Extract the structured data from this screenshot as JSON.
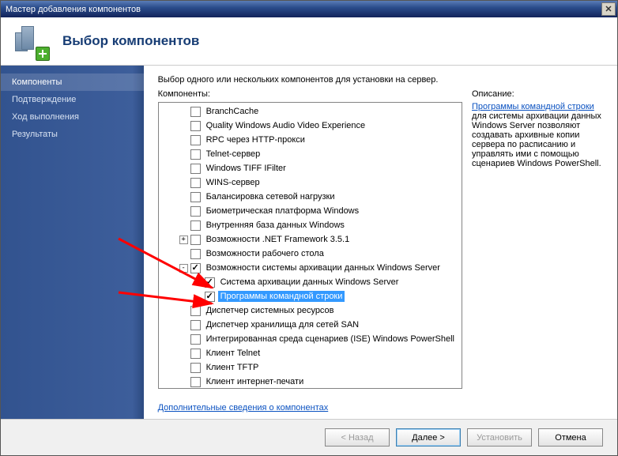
{
  "window": {
    "title": "Мастер добавления компонентов"
  },
  "header": {
    "title": "Выбор компонентов"
  },
  "sidebar": {
    "steps": [
      {
        "label": "Компоненты",
        "current": true
      },
      {
        "label": "Подтверждение",
        "current": false
      },
      {
        "label": "Ход выполнения",
        "current": false
      },
      {
        "label": "Результаты",
        "current": false
      }
    ]
  },
  "main": {
    "instruction": "Выбор одного или нескольких компонентов для установки на сервер.",
    "components_label": "Компоненты:",
    "description_label": "Описание:",
    "more_info": "Дополнительные сведения о компонентах"
  },
  "tree": [
    {
      "label": "BranchCache",
      "depth": 0,
      "checked": false
    },
    {
      "label": "Quality Windows Audio Video Experience",
      "depth": 0,
      "checked": false
    },
    {
      "label": "RPC через HTTP-прокси",
      "depth": 0,
      "checked": false
    },
    {
      "label": "Telnet-сервер",
      "depth": 0,
      "checked": false
    },
    {
      "label": "Windows TIFF IFilter",
      "depth": 0,
      "checked": false
    },
    {
      "label": "WINS-сервер",
      "depth": 0,
      "checked": false
    },
    {
      "label": "Балансировка сетевой нагрузки",
      "depth": 0,
      "checked": false
    },
    {
      "label": "Биометрическая платформа Windows",
      "depth": 0,
      "checked": false
    },
    {
      "label": "Внутренняя база данных Windows",
      "depth": 0,
      "checked": false
    },
    {
      "label": "Возможности .NET Framework 3.5.1",
      "depth": 0,
      "checked": false,
      "expander": "+"
    },
    {
      "label": "Возможности рабочего стола",
      "depth": 0,
      "checked": false
    },
    {
      "label": "Возможности системы архивации данных Windows Server",
      "depth": 0,
      "checked": true,
      "expander": "-"
    },
    {
      "label": "Система архивации данных Windows Server",
      "depth": 1,
      "checked": true
    },
    {
      "label": "Программы командной строки",
      "depth": 1,
      "checked": true,
      "selected": true
    },
    {
      "label": "Диспетчер системных ресурсов",
      "depth": 0,
      "checked": false
    },
    {
      "label": "Диспетчер хранилища для сетей SAN",
      "depth": 0,
      "checked": false
    },
    {
      "label": "Интегрированная среда сценариев (ISE) Windows PowerShell",
      "depth": 0,
      "checked": false
    },
    {
      "label": "Клиент Telnet",
      "depth": 0,
      "checked": false
    },
    {
      "label": "Клиент TFTP",
      "depth": 0,
      "checked": false
    },
    {
      "label": "Клиент интернет-печати",
      "depth": 0,
      "checked": false
    }
  ],
  "description": {
    "link_text": "Программы командной строки",
    "text_after": " для системы архивации данных Windows Server позволяют создавать архивные копии сервера по расписанию и управлять ими с помощью сценариев Windows PowerShell."
  },
  "buttons": {
    "back": "< Назад",
    "next": "Далее >",
    "install": "Установить",
    "cancel": "Отмена"
  }
}
